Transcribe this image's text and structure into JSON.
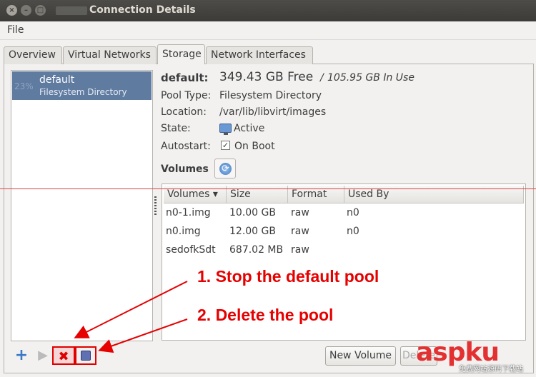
{
  "window": {
    "title": "Connection Details",
    "close_glyph": "×",
    "min_glyph": "–",
    "max_glyph": "□"
  },
  "menubar": {
    "file": "File"
  },
  "tabs": [
    {
      "label": "Overview",
      "active": false
    },
    {
      "label": "Virtual Networks",
      "active": false
    },
    {
      "label": "Storage",
      "active": true
    },
    {
      "label": "Network Interfaces",
      "active": false
    }
  ],
  "pool_list": [
    {
      "usage": "23%",
      "name": "default",
      "type": "Filesystem Directory",
      "selected": true
    }
  ],
  "details": {
    "name": "default:",
    "free": "349.43 GB Free",
    "separator": "/",
    "in_use": "105.95 GB In Use",
    "pool_type_label": "Pool Type:",
    "pool_type": "Filesystem Directory",
    "location_label": "Location:",
    "location": "/var/lib/libvirt/images",
    "state_label": "State:",
    "state": "Active",
    "autostart_label": "Autostart:",
    "autostart_check": "✓",
    "autostart": "On Boot",
    "volumes_label": "Volumes",
    "refresh_glyph": "⟳"
  },
  "volume_table": {
    "headers": [
      "Volumes ▾",
      "Size",
      "Format",
      "Used By"
    ],
    "rows": [
      [
        "n0-1.img",
        "10.00 GB",
        "raw",
        "n0"
      ],
      [
        "n0.img",
        "12.00 GB",
        "raw",
        "n0"
      ],
      [
        "sedofkSdt",
        "687.02 MB",
        "raw",
        ""
      ]
    ]
  },
  "toolbar": {
    "add_glyph": "+",
    "start_glyph": "▶",
    "stop_glyph": "✖",
    "new_volume": "New Volume",
    "delete_volume": "Delete"
  },
  "annotations": {
    "step1": "1. Stop the default pool",
    "step2": "2. Delete the pool"
  },
  "watermark": {
    "brand": "aspku",
    "subtitle": "免费网站源码下载站"
  },
  "colors": {
    "annotation_red": "#e60000",
    "selection_blue": "#5f7ba0",
    "titlebar": "#3c3b37"
  }
}
